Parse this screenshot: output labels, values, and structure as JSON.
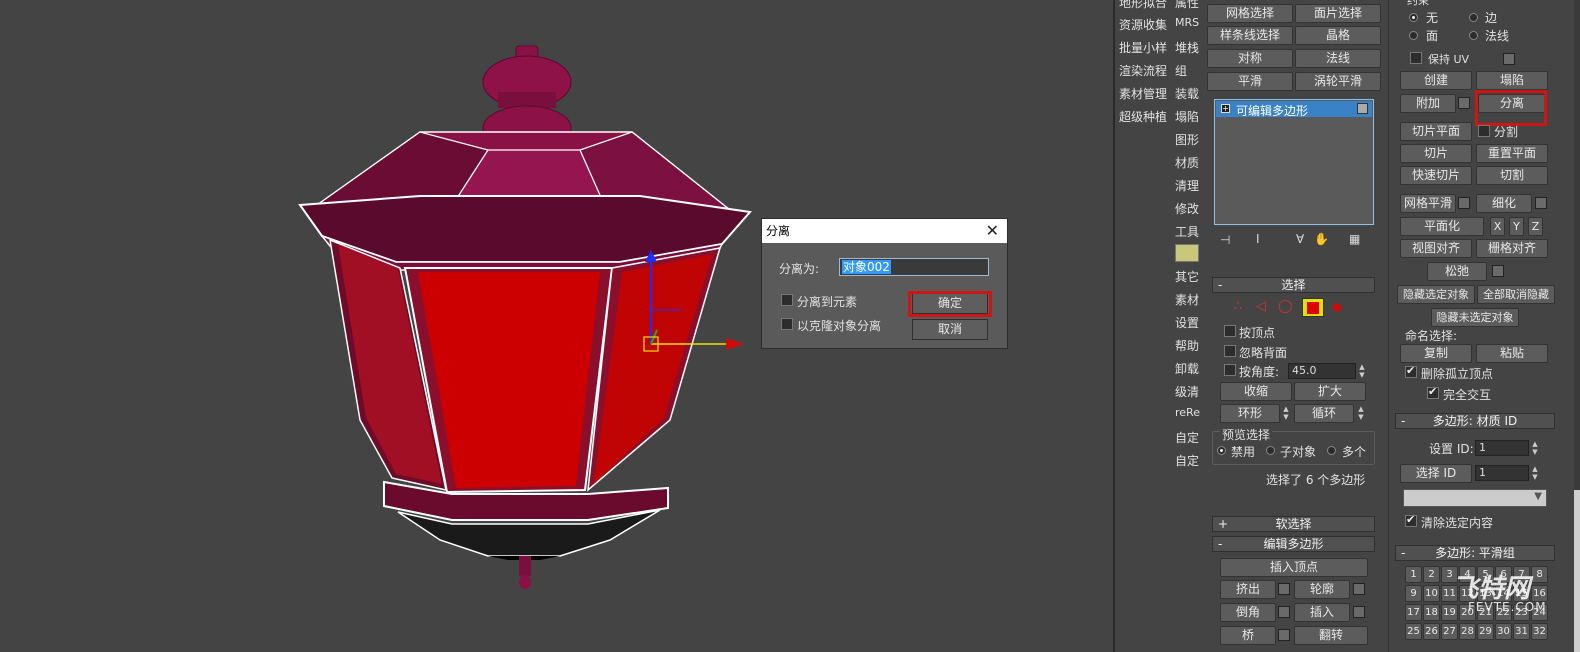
{
  "left_strip": {
    "col1": [
      "地形拟合",
      "资源收集",
      "批量小样",
      "渲染流程",
      "素材管理",
      "超级种植"
    ],
    "col2": [
      "属性",
      "MRS",
      "堆栈",
      "组",
      "装载",
      "塌陷",
      "图形",
      "材质",
      "清理",
      "修改",
      "工具",
      "",
      "其它",
      "素材",
      "设置",
      "帮助",
      "卸载",
      "级清",
      "reRe",
      "自定",
      "自定"
    ]
  },
  "modifier_panel": {
    "top_buttons": [
      [
        "网格选择",
        "面片选择"
      ],
      [
        "样条线选择",
        "晶格"
      ],
      [
        "对称",
        "法线"
      ],
      [
        "平滑",
        "涡轮平滑"
      ]
    ],
    "stack_item": "可编辑多边形",
    "select_rollout": {
      "title": "选择",
      "by_vertex": "按顶点",
      "ignore_backfacing": "忽略背面",
      "by_angle": "按角度:",
      "angle_value": "45.0",
      "shrink": "收缩",
      "grow": "扩大",
      "ring": "环形",
      "loop": "循环",
      "preview_title": "预览选择",
      "preview_disabled": "禁用",
      "preview_subobj": "子对象",
      "preview_multi": "多个",
      "status": "选择了 6 个多边形"
    },
    "soft_select_title": "软选择",
    "edit_poly_title": "编辑多边形",
    "insert_vertex": "插入顶点",
    "extrude": "挤出",
    "outline": "轮廓",
    "bevel": "倒角",
    "inset": "插入",
    "bridge": "桥",
    "flip": "翻转"
  },
  "right_panel": {
    "constraint_title": "约束",
    "constraint_none": "无",
    "constraint_edge": "边",
    "constraint_face": "面",
    "constraint_normal": "法线",
    "preserve_uv": "保持 UV",
    "create": "创建",
    "collapse": "塌陷",
    "attach": "附加",
    "detach": "分离",
    "slice_plane": "切片平面",
    "split": "分割",
    "slice": "切片",
    "reset_plane": "重置平面",
    "quickslice": "快速切片",
    "cut": "切割",
    "meshsmooth": "网格平滑",
    "tessellate": "细化",
    "make_planar": "平面化",
    "x": "X",
    "y": "Y",
    "z": "Z",
    "view_align": "视图对齐",
    "grid_align": "栅格对齐",
    "relax": "松弛",
    "hide_selected": "隐藏选定对象",
    "unhide_all": "全部取消隐藏",
    "hide_unselected": "隐藏未选定对象",
    "named_sel": "命名选择:",
    "copy": "复制",
    "paste": "粘贴",
    "delete_isolated": "删除孤立顶点",
    "full_interactivity": "完全交互",
    "material_id_title": "多边形: 材质 ID",
    "set_id": "设置 ID:",
    "set_id_value": "1",
    "select_id": "选择 ID",
    "select_id_value": "1",
    "clear_selection": "清除选定内容",
    "smoothing_title": "多边形: 平滑组",
    "smoothing_numbers": [
      "1",
      "2",
      "3",
      "4",
      "5",
      "6",
      "7",
      "8",
      "9",
      "10",
      "11",
      "12",
      "13",
      "14",
      "15",
      "16",
      "17",
      "18",
      "19",
      "20",
      "21",
      "22",
      "23",
      "24",
      "25",
      "26",
      "27",
      "28",
      "29",
      "30",
      "31",
      "32"
    ]
  },
  "dialog": {
    "title": "分离",
    "detach_as_label": "分离为:",
    "detach_as_value": "对象002",
    "to_element": "分离到元素",
    "as_clone": "以克隆对象分离",
    "ok": "确定",
    "cancel": "取消"
  },
  "watermark": {
    "main": "飞特网",
    "sub": "FEVTE.COM"
  },
  "colors": {
    "viewport_bg": "#444444",
    "lamp_red": "#cc0000",
    "lamp_roof": "#8a1040",
    "highlight_red": "#d11515"
  }
}
